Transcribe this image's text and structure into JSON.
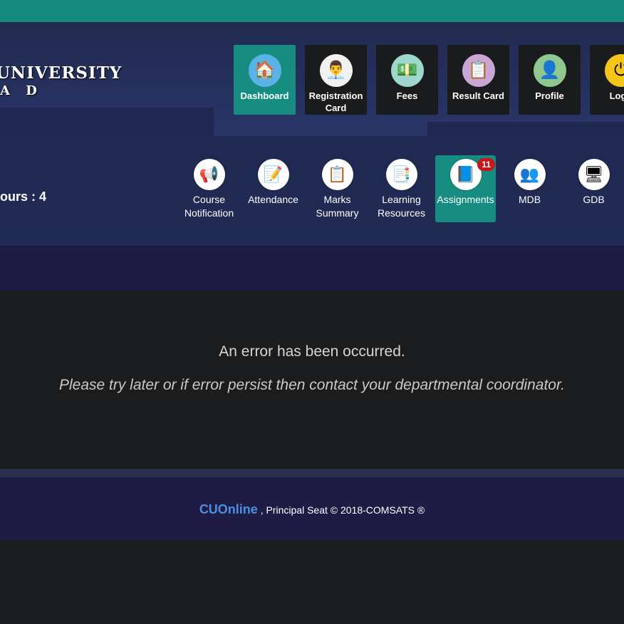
{
  "header": {
    "university_text": "UNIVERSITY",
    "university_sub": "A D",
    "hours_label": "ours : 4"
  },
  "main_nav": [
    {
      "label": "Dashboard",
      "icon": "home-icon",
      "glyph": "🏠",
      "bg": "#5ab3e6",
      "active": true
    },
    {
      "label": "Registration Card",
      "icon": "registration-card-icon",
      "glyph": "👨‍💼",
      "bg": "#f2f2f2",
      "active": false
    },
    {
      "label": "Fees",
      "icon": "fees-icon",
      "glyph": "💵",
      "bg": "#9ed8cc",
      "active": false
    },
    {
      "label": "Result Card",
      "icon": "result-card-icon",
      "glyph": "📋",
      "bg": "#c9a6d6",
      "active": false
    },
    {
      "label": "Profile",
      "icon": "profile-icon",
      "glyph": "👤",
      "bg": "#8fc78e",
      "active": false
    },
    {
      "label": "Logo",
      "icon": "logout-icon",
      "glyph": "⏻",
      "bg": "#f5c518",
      "active": false
    }
  ],
  "sub_nav": [
    {
      "label": "Course Notification",
      "icon": "megaphone-icon",
      "glyph": "📢",
      "active": false
    },
    {
      "label": "Attendance",
      "icon": "attendance-clipboard-icon",
      "glyph": "📝",
      "active": false
    },
    {
      "label": "Marks Summary",
      "icon": "marks-clipboard-icon",
      "glyph": "📋",
      "active": false
    },
    {
      "label": "Learning Resources",
      "icon": "learning-resources-icon",
      "glyph": "📑",
      "active": false
    },
    {
      "label": "Assignments",
      "icon": "assignments-book-icon",
      "glyph": "📘",
      "active": true,
      "badge": "11"
    },
    {
      "label": "MDB",
      "icon": "discussion-group-icon",
      "glyph": "👥",
      "active": false
    },
    {
      "label": "GDB",
      "icon": "presentation-screen-icon",
      "glyph": "🖥",
      "active": false
    }
  ],
  "error": {
    "title": "An error has been occurred.",
    "message": "Please try later or if error persist then contact your departmental coordinator."
  },
  "footer": {
    "brand": "CUOnline",
    "text": " , Principal Seat © 2018-COMSATS ®"
  },
  "colors": {
    "accent": "#168d80",
    "brand_link": "#4a8fe0",
    "badge": "#c8161d"
  }
}
